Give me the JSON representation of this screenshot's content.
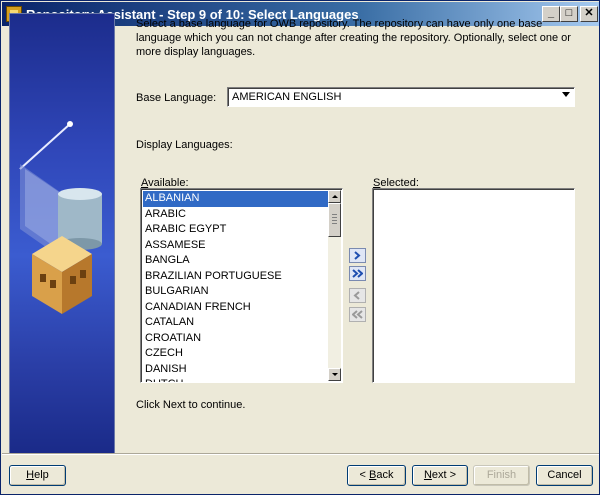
{
  "window": {
    "title": "Repository Assistant - Step 9 of 10: Select Languages",
    "minimize_glyph": "_",
    "maximize_glyph": "□",
    "close_glyph": "✕"
  },
  "intro_text": "Select a base language for OWB repository. The repository can have only one base language which you can not change after creating the repository.  Optionally, select one or more display languages.",
  "base_language": {
    "label": "Base Language:",
    "value": "AMERICAN ENGLISH"
  },
  "display_languages_label": "Display Languages:",
  "available": {
    "label_first": "A",
    "label_rest": "vailable:",
    "items": [
      "ALBANIAN",
      "ARABIC",
      "ARABIC EGYPT",
      "ASSAMESE",
      "BANGLA",
      "BRAZILIAN PORTUGUESE",
      "BULGARIAN",
      "CANADIAN FRENCH",
      "CATALAN",
      "CROATIAN",
      "CZECH",
      "DANISH",
      "DUTCH"
    ],
    "selected_index": 0
  },
  "selected": {
    "label_first": "S",
    "label_rest": "elected:",
    "items": []
  },
  "shuttle_icons": {
    "move_one": "move-right-icon",
    "move_all": "move-all-right-icon",
    "remove_one": "move-left-icon",
    "remove_all": "move-all-left-icon"
  },
  "footer_hint": "Click Next to continue.",
  "buttons": {
    "help_first": "H",
    "help_rest": "elp",
    "back_prefix": "< ",
    "back_first": "B",
    "back_rest": "ack",
    "next_first": "N",
    "next_rest": "ext >",
    "finish": "Finish",
    "cancel": "Cancel"
  }
}
